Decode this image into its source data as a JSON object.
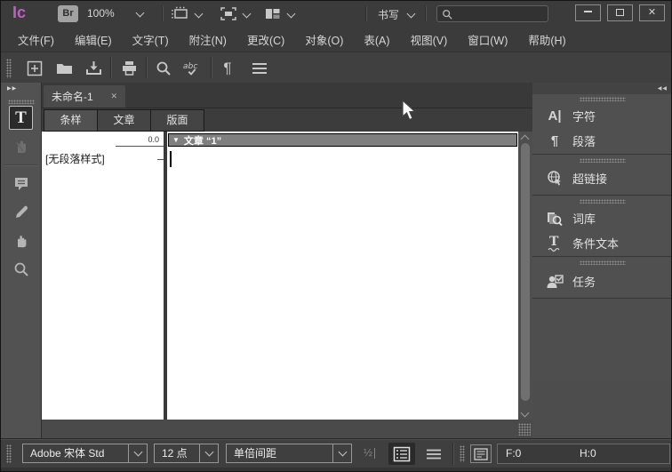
{
  "titlebar": {
    "logo": "Ic",
    "bridge_label": "Br",
    "zoom_level": "100%",
    "workspace": "书写",
    "search_placeholder": "",
    "close_glyph": "✕"
  },
  "menubar": {
    "items": [
      "文件(F)",
      "编辑(E)",
      "文字(T)",
      "附注(N)",
      "更改(C)",
      "对象(O)",
      "表(A)",
      "视图(V)",
      "窗口(W)",
      "帮助(H)"
    ]
  },
  "document": {
    "tab_title": "未命名-1",
    "tab_close_glyph": "✕",
    "view_tabs": [
      "条样",
      "文章",
      "版面"
    ],
    "active_view_tab": "条样",
    "depth_value": "0.0",
    "paragraph_style": "[无段落样式]",
    "story_header_arrow": "▼",
    "story_header": "文章 “1”"
  },
  "tools": {
    "expand_glyph": "▶▶",
    "type_tool_glyph": "T"
  },
  "right_dock": {
    "collapse_glyph": "◀◀",
    "panels": [
      {
        "label": "字符",
        "glyph": "A|"
      },
      {
        "label": "段落",
        "glyph": "¶"
      },
      {
        "label": "超链接"
      },
      {
        "label": "词库"
      },
      {
        "label": "条件文本",
        "glyph": "T"
      },
      {
        "label": "任务"
      }
    ]
  },
  "bottombar": {
    "font_family": "Adobe 宋体 Std",
    "font_size": "12 点",
    "leading": "单倍间距",
    "line_numbers_glyph": "½",
    "copyfit_f": "F:0",
    "copyfit_h": "H:0"
  },
  "colors": {
    "accent_logo": "#bd60c0",
    "ui_dark": "#3c3c3c",
    "panel_gray": "#4e4e4e",
    "paper_white": "#ffffff"
  }
}
